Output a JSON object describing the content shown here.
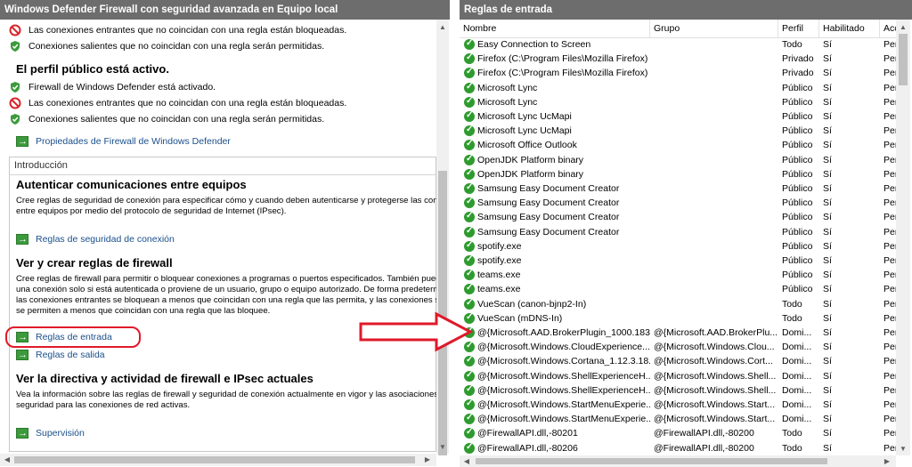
{
  "left": {
    "title": "Windows Defender Firewall con seguridad avanzada en Equipo local",
    "top_rows": [
      {
        "icon": "blocked-icon",
        "text": "Las conexiones entrantes que no coincidan con una regla están bloqueadas."
      },
      {
        "icon": "shield-check-icon",
        "text": "Conexiones salientes que no coincidan con una regla serán permitidas."
      }
    ],
    "public_profile": {
      "heading": "El perfil público está activo.",
      "rows": [
        {
          "icon": "shield-check-icon",
          "text": "Firewall de Windows Defender está activado."
        },
        {
          "icon": "blocked-icon",
          "text": "Las conexiones entrantes que no coincidan con una regla están bloqueadas."
        },
        {
          "icon": "shield-check-icon",
          "text": "Conexiones salientes que no coincidan con una regla serán permitidas."
        }
      ],
      "link": "Propiedades de Firewall de Windows Defender"
    },
    "intro": {
      "label": "Introducción",
      "auth": {
        "heading": "Autenticar comunicaciones entre equipos",
        "desc": [
          "Cree reglas de seguridad de conexión para especificar cómo y cuando deben autenticarse y protegerse las conexiones",
          "entre equipos por medio del protocolo de seguridad de Internet (IPsec)."
        ],
        "link": "Reglas de seguridad de conexión"
      },
      "rules": {
        "heading": "Ver y crear reglas de firewall",
        "desc": [
          "Cree reglas de firewall para permitir o bloquear conexiones a programas o puertos especificados. También puede permitir",
          "una conexión solo si está autenticada o proviene de un usuario, grupo o equipo autorizado. De forma predeterminada",
          "las conexiones entrantes se bloquean a menos que coincidan con una regla que las permita, y las conexiones salientes",
          "se permiten a menos que coincidan con una regla que las bloquee."
        ],
        "link_in": "Reglas de entrada",
        "link_out": "Reglas de salida"
      },
      "policy": {
        "heading": "Ver la directiva y actividad de firewall e IPsec actuales",
        "desc": [
          "Vea la información sobre las reglas de firewall y seguridad de conexión actualmente en vigor y las asociaciones de",
          "seguridad para las conexiones de red activas."
        ],
        "link": "Supervisión"
      }
    }
  },
  "right": {
    "title": "Reglas de entrada",
    "columns": [
      "Nombre",
      "Grupo",
      "Perfil",
      "Habilitado",
      "Acc"
    ],
    "rows": [
      [
        "Easy Connection to Screen",
        "",
        "Todo",
        "Sí",
        "Per"
      ],
      [
        "Firefox (C:\\Program Files\\Mozilla Firefox)",
        "",
        "Privado",
        "Sí",
        "Per"
      ],
      [
        "Firefox (C:\\Program Files\\Mozilla Firefox)",
        "",
        "Privado",
        "Sí",
        "Per"
      ],
      [
        "Microsoft Lync",
        "",
        "Público",
        "Sí",
        "Per"
      ],
      [
        "Microsoft Lync",
        "",
        "Público",
        "Sí",
        "Per"
      ],
      [
        "Microsoft Lync UcMapi",
        "",
        "Público",
        "Sí",
        "Per"
      ],
      [
        "Microsoft Lync UcMapi",
        "",
        "Público",
        "Sí",
        "Per"
      ],
      [
        "Microsoft Office Outlook",
        "",
        "Público",
        "Sí",
        "Per"
      ],
      [
        "OpenJDK Platform binary",
        "",
        "Público",
        "Sí",
        "Per"
      ],
      [
        "OpenJDK Platform binary",
        "",
        "Público",
        "Sí",
        "Per"
      ],
      [
        "Samsung Easy Document Creator",
        "",
        "Público",
        "Sí",
        "Per"
      ],
      [
        "Samsung Easy Document Creator",
        "",
        "Público",
        "Sí",
        "Per"
      ],
      [
        "Samsung Easy Document Creator",
        "",
        "Público",
        "Sí",
        "Per"
      ],
      [
        "Samsung Easy Document Creator",
        "",
        "Público",
        "Sí",
        "Per"
      ],
      [
        "spotify.exe",
        "",
        "Público",
        "Sí",
        "Per"
      ],
      [
        "spotify.exe",
        "",
        "Público",
        "Sí",
        "Per"
      ],
      [
        "teams.exe",
        "",
        "Público",
        "Sí",
        "Per"
      ],
      [
        "teams.exe",
        "",
        "Público",
        "Sí",
        "Per"
      ],
      [
        "VueScan (canon-bjnp2-In)",
        "",
        "Todo",
        "Sí",
        "Per"
      ],
      [
        "VueScan (mDNS-In)",
        "",
        "Todo",
        "Sí",
        "Per"
      ],
      [
        "@{Microsoft.AAD.BrokerPlugin_1000.183...",
        "@{Microsoft.AAD.BrokerPlu...",
        "Domi...",
        "Sí",
        "Per"
      ],
      [
        "@{Microsoft.Windows.CloudExperience...",
        "@{Microsoft.Windows.Clou...",
        "Domi...",
        "Sí",
        "Per"
      ],
      [
        "@{Microsoft.Windows.Cortana_1.12.3.18...",
        "@{Microsoft.Windows.Cort...",
        "Domi...",
        "Sí",
        "Per"
      ],
      [
        "@{Microsoft.Windows.ShellExperienceH...",
        "@{Microsoft.Windows.Shell...",
        "Domi...",
        "Sí",
        "Per"
      ],
      [
        "@{Microsoft.Windows.ShellExperienceH...",
        "@{Microsoft.Windows.Shell...",
        "Domi...",
        "Sí",
        "Per"
      ],
      [
        "@{Microsoft.Windows.StartMenuExperie...",
        "@{Microsoft.Windows.Start...",
        "Domi...",
        "Sí",
        "Per"
      ],
      [
        "@{Microsoft.Windows.StartMenuExperie...",
        "@{Microsoft.Windows.Start...",
        "Domi...",
        "Sí",
        "Per"
      ],
      [
        "@FirewallAPI.dll,-80201",
        "@FirewallAPI.dll,-80200",
        "Todo",
        "Sí",
        "Per"
      ],
      [
        "@FirewallAPI.dll,-80206",
        "@FirewallAPI.dll,-80200",
        "Todo",
        "Sí",
        "Per"
      ]
    ]
  },
  "colors": {
    "title_bar": "#6d6d6d",
    "link": "#1a4f8b",
    "highlight": "#e0192a",
    "check": "#2e9b2e",
    "blocked": "#d9262c"
  }
}
